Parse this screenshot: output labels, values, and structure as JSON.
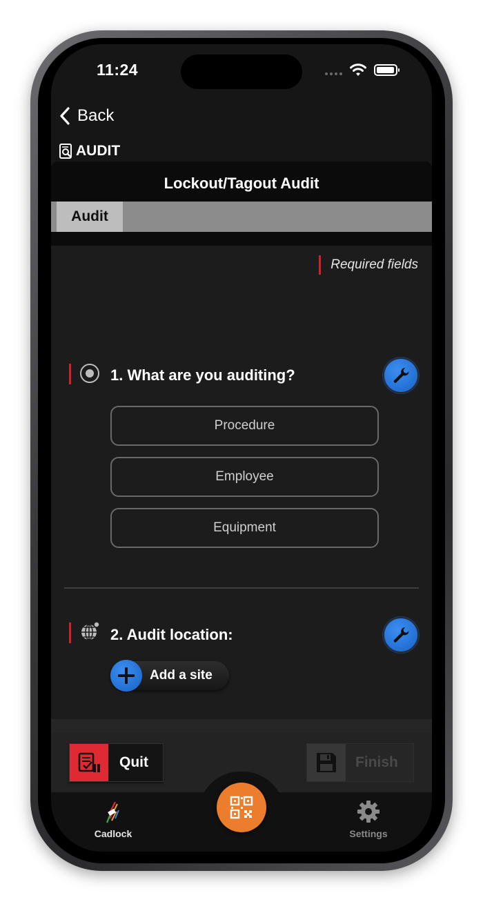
{
  "status_bar": {
    "time": "11:24"
  },
  "nav": {
    "back_label": "Back"
  },
  "app": {
    "section_title": "AUDIT"
  },
  "header": {
    "title": "Lockout/Tagout Audit"
  },
  "tabs": [
    {
      "label": "Audit",
      "active": true
    }
  ],
  "form": {
    "required_note": "Required fields",
    "question1": {
      "title": "1. What are you auditing?",
      "options": [
        "Procedure",
        "Employee",
        "Equipment"
      ]
    },
    "question2": {
      "title": "2. Audit location:",
      "add_site_label": "Add a site"
    }
  },
  "actions": {
    "quit_label": "Quit",
    "finish_label": "Finish",
    "finish_enabled": false
  },
  "tabbar": {
    "items": [
      {
        "label": "Cadlock",
        "icon": "cadlock-icon"
      },
      {
        "label": "Settings",
        "icon": "gear-icon"
      }
    ],
    "center_icon": "qr-code-icon"
  },
  "colors": {
    "accent_red": "#d3202a",
    "accent_blue": "#1e74dd",
    "scan_orange": "#ec7d2c",
    "background": "#1c1c1c"
  }
}
